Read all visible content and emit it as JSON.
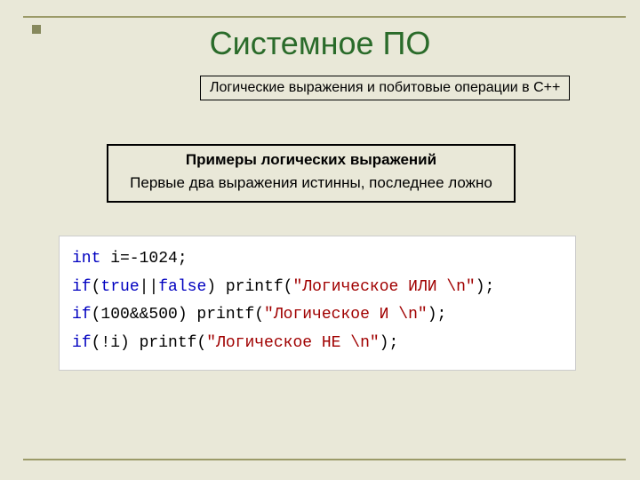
{
  "title": "Системное ПО",
  "subtitle": "Логические выражения и побитовые операции в C++",
  "example": {
    "heading": "Примеры логических выражений",
    "note": "Первые два выражения истинны, последнее ложно"
  },
  "code": {
    "line1": {
      "kw": "int",
      "rest": " i=-1024;"
    },
    "line2": {
      "kw1": "if",
      "p1": "(",
      "kw2": "true",
      "op1": "||",
      "kw3": "false",
      "p2": ") printf(",
      "str": "\"Логическое ИЛИ \\n\"",
      "p3": ");"
    },
    "line3": {
      "kw1": "if",
      "p1": "(100&&500) printf(",
      "str": "\"Логическое И \\n\"",
      "p2": ");"
    },
    "line4": {
      "kw1": "if",
      "p1": "(!i) printf(",
      "str": "\"Логическое НЕ \\n\"",
      "p2": ");"
    }
  }
}
